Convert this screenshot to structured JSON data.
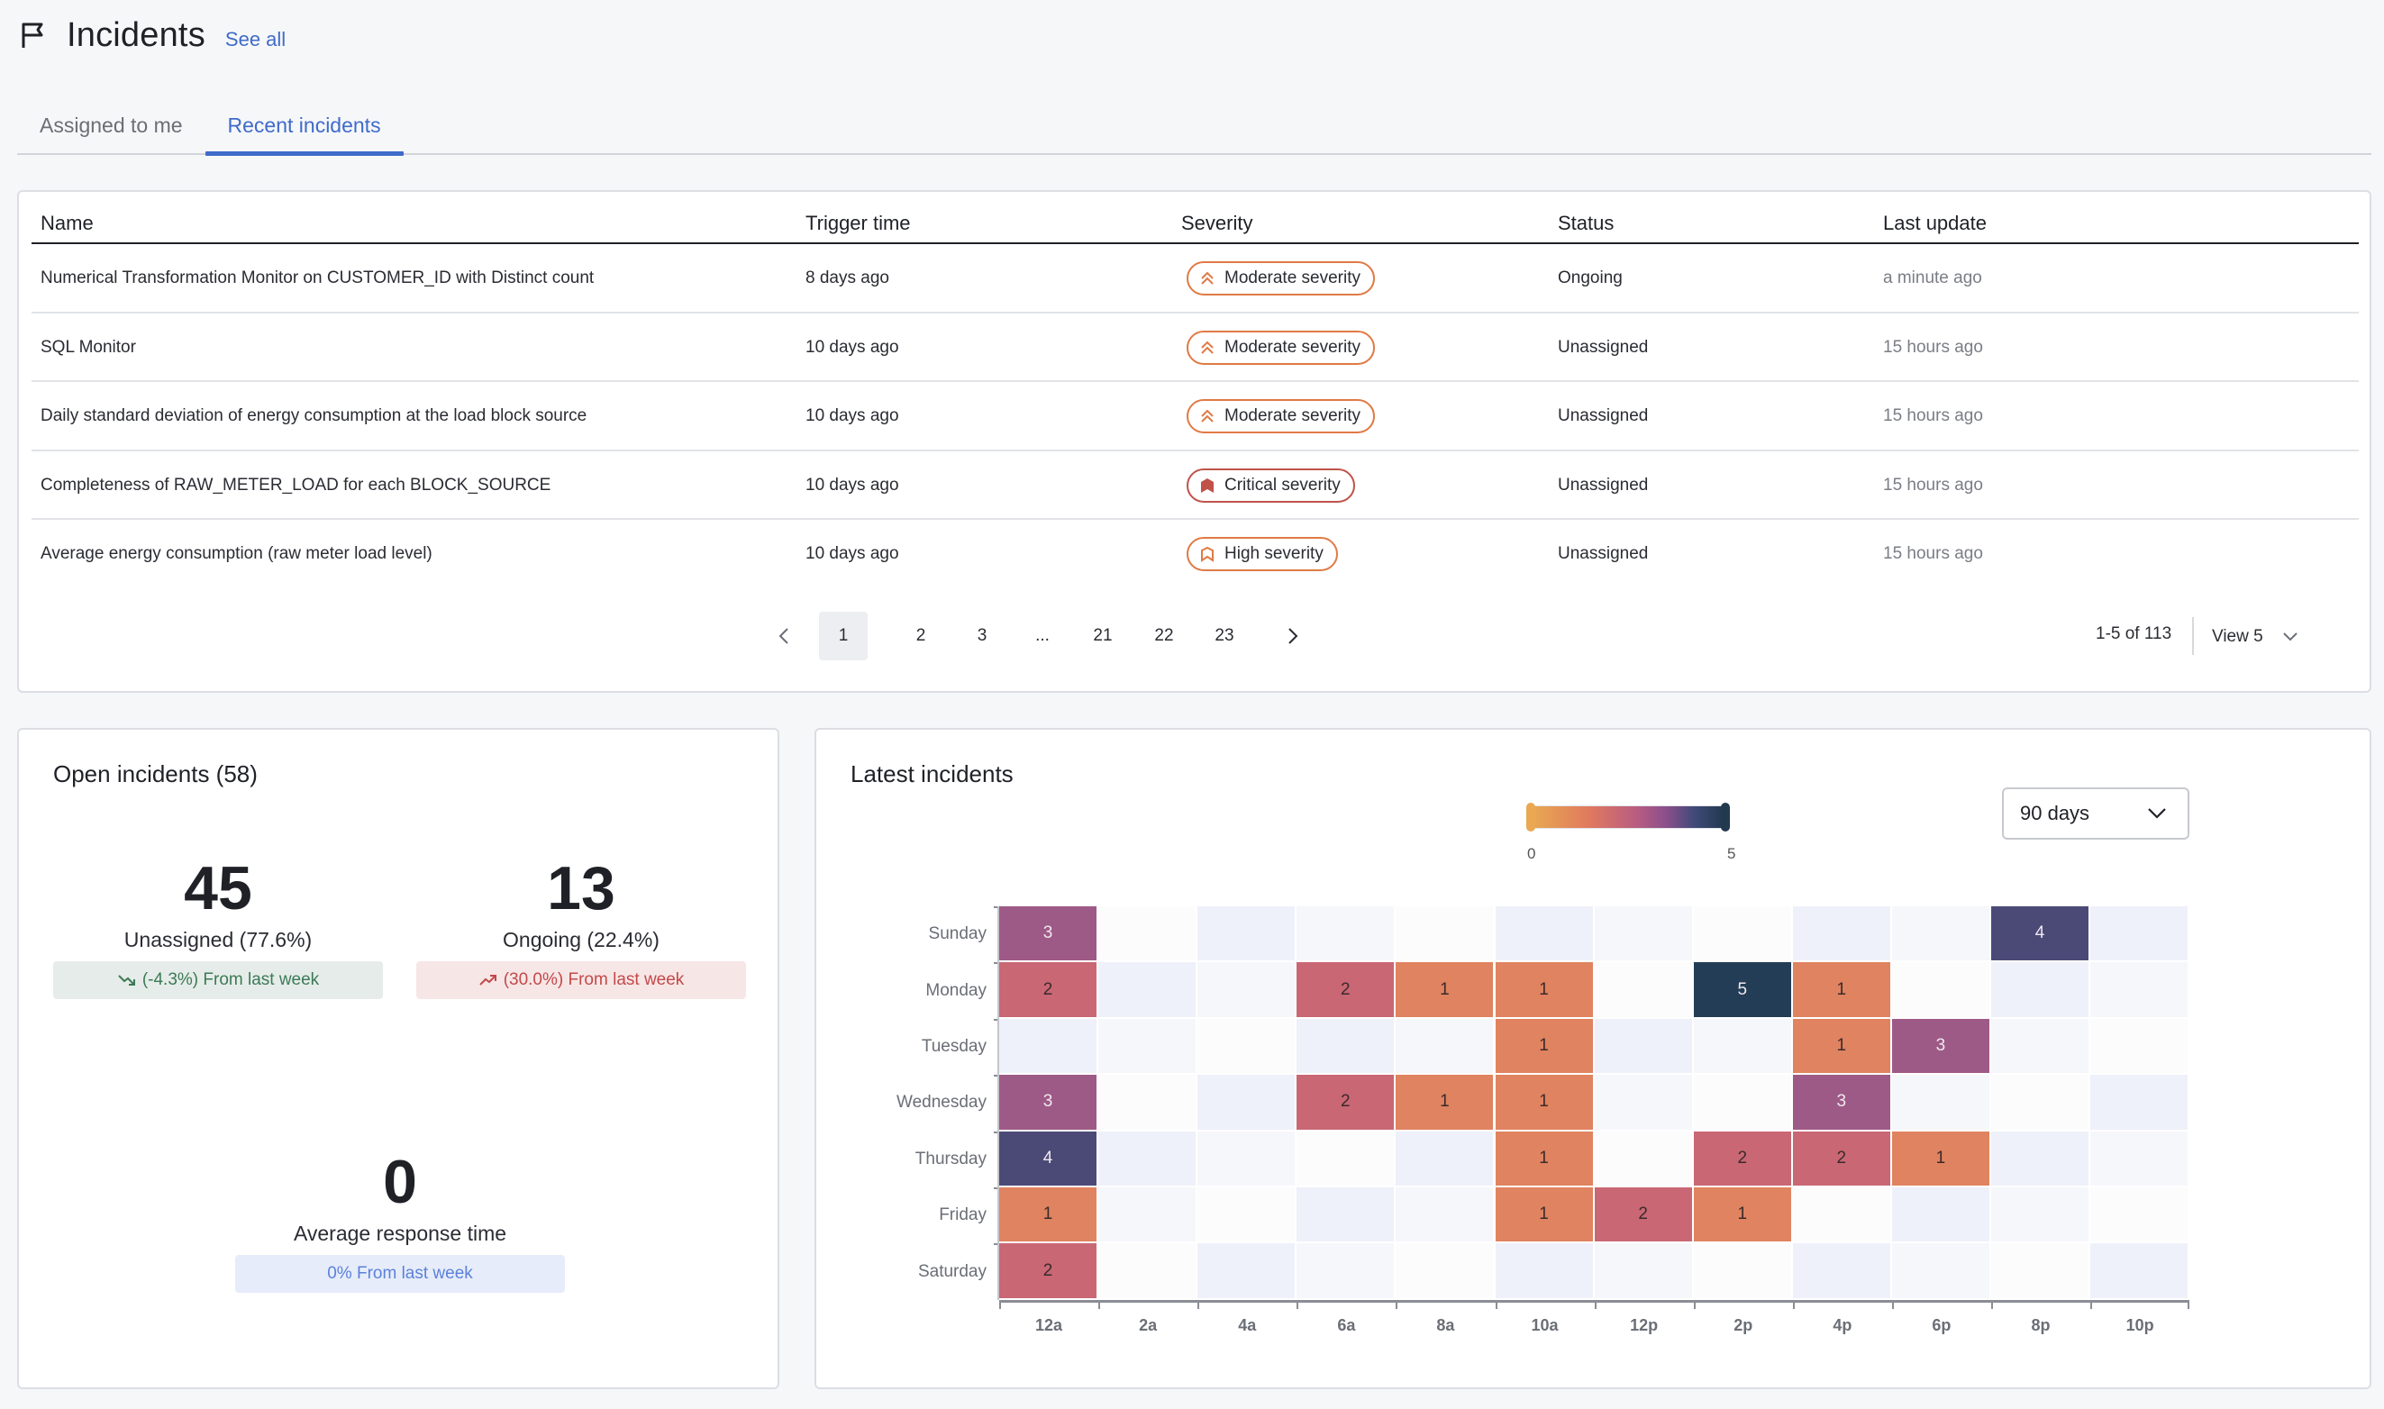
{
  "header": {
    "title": "Incidents",
    "see_all": "See all",
    "icon": "flag-icon"
  },
  "tabs": [
    {
      "label": "Assigned to me",
      "active": false
    },
    {
      "label": "Recent incidents",
      "active": true
    }
  ],
  "table": {
    "columns": [
      "Name",
      "Trigger time",
      "Severity",
      "Status",
      "Last update"
    ],
    "rows": [
      {
        "name": "Numerical Transformation Monitor on CUSTOMER_ID with Distinct count",
        "trigger": "8 days ago",
        "severity": "Moderate severity",
        "severity_level": "moderate",
        "status": "Ongoing",
        "updated": "a minute ago"
      },
      {
        "name": "SQL Monitor",
        "trigger": "10 days ago",
        "severity": "Moderate severity",
        "severity_level": "moderate",
        "status": "Unassigned",
        "updated": "15 hours ago"
      },
      {
        "name": "Daily standard deviation of energy consumption at the load block source",
        "trigger": "10 days ago",
        "severity": "Moderate severity",
        "severity_level": "moderate",
        "status": "Unassigned",
        "updated": "15 hours ago"
      },
      {
        "name": "Completeness of RAW_METER_LOAD for each BLOCK_SOURCE",
        "trigger": "10 days ago",
        "severity": "Critical severity",
        "severity_level": "critical",
        "status": "Unassigned",
        "updated": "15 hours ago"
      },
      {
        "name": "Average energy consumption (raw meter load level)",
        "trigger": "10 days ago",
        "severity": "High severity",
        "severity_level": "high",
        "status": "Unassigned",
        "updated": "15 hours ago"
      }
    ],
    "severity_colors": {
      "moderate": "#e07a45",
      "critical": "#c0524a",
      "high": "#e07a45"
    }
  },
  "pagination": {
    "pages": [
      "1",
      "2",
      "3",
      "...",
      "21",
      "22",
      "23"
    ],
    "current": "1",
    "range_text": "1-5 of 113",
    "view_label": "View 5"
  },
  "open_incidents": {
    "title": "Open incidents (58)",
    "unassigned": {
      "value": "45",
      "label": "Unassigned (77.6%)",
      "change": "(-4.3%) From last week",
      "trend": "down"
    },
    "ongoing": {
      "value": "13",
      "label": "Ongoing (22.4%)",
      "change": "(30.0%) From last week",
      "trend": "up"
    },
    "response": {
      "value": "0",
      "label": "Average response time",
      "change": "0% From last week"
    }
  },
  "latest_incidents": {
    "title": "Latest incidents",
    "range_select": "90 days",
    "legend_min": "0",
    "legend_max": "5"
  },
  "chart_data": {
    "type": "heatmap",
    "title": "Latest incidents",
    "x": [
      "12a",
      "2a",
      "4a",
      "6a",
      "8a",
      "10a",
      "12p",
      "2p",
      "4p",
      "6p",
      "8p",
      "10p"
    ],
    "y": [
      "Sunday",
      "Monday",
      "Tuesday",
      "Wednesday",
      "Thursday",
      "Friday",
      "Saturday"
    ],
    "values": [
      [
        3,
        0,
        0,
        0,
        0,
        0,
        0,
        0,
        0,
        0,
        4,
        0
      ],
      [
        2,
        0,
        0,
        2,
        1,
        1,
        0,
        5,
        1,
        0,
        0,
        0
      ],
      [
        0,
        0,
        0,
        0,
        0,
        1,
        0,
        0,
        1,
        3,
        0,
        0
      ],
      [
        3,
        0,
        0,
        2,
        1,
        1,
        0,
        0,
        3,
        0,
        0,
        0
      ],
      [
        4,
        0,
        0,
        0,
        0,
        1,
        0,
        2,
        2,
        1,
        0,
        0
      ],
      [
        1,
        0,
        0,
        0,
        0,
        1,
        2,
        1,
        0,
        0,
        0,
        0
      ],
      [
        2,
        0,
        0,
        0,
        0,
        0,
        0,
        0,
        0,
        0,
        0,
        0
      ]
    ],
    "color_scale": {
      "min": 0,
      "max": 5,
      "colors": {
        "1": "#e08360",
        "2": "#c96775",
        "3": "#9e5a87",
        "4": "#4b4a77",
        "5": "#223d55"
      }
    },
    "legend": "top-center"
  }
}
